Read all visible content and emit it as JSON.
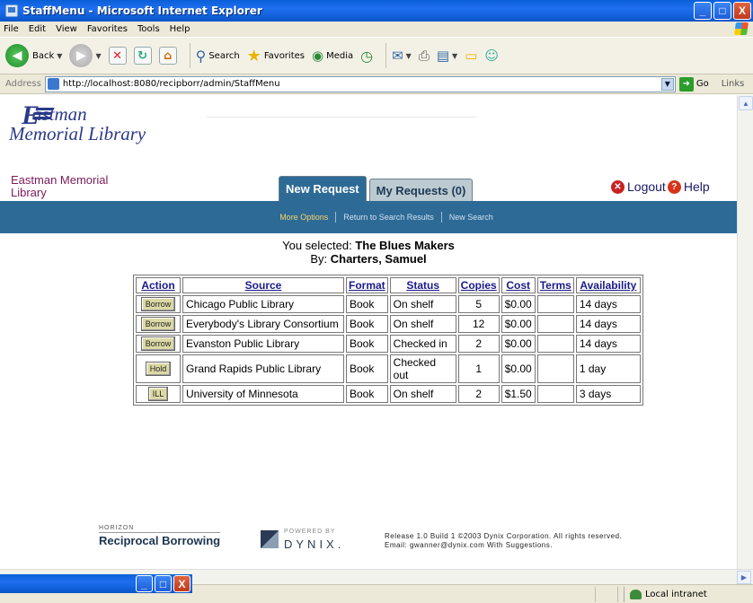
{
  "window": {
    "title": "StaffMenu - Microsoft Internet Explorer",
    "minimize": "_",
    "maximize": "□",
    "close": "X"
  },
  "menu": [
    "File",
    "Edit",
    "View",
    "Favorites",
    "Tools",
    "Help"
  ],
  "toolbar": {
    "back": "Back",
    "search": "Search",
    "favorites": "Favorites",
    "media": "Media"
  },
  "address": {
    "label": "Address",
    "url": "http://localhost:8080/recipborr/admin/StaffMenu",
    "go": "Go",
    "links": "Links"
  },
  "logo": {
    "line1": "astman",
    "line2": "Memorial Library",
    "initial": "E"
  },
  "library_name": "Eastman Memorial Library",
  "tabs": [
    {
      "label": "New Request",
      "active": true
    },
    {
      "label": "My Requests (0)",
      "active": false
    }
  ],
  "header_links": {
    "logout": "Logout",
    "help": "Help"
  },
  "nav": [
    "More Options",
    "Return to Search Results",
    "New Search"
  ],
  "selection": {
    "prefix": "You selected:",
    "title": "The Blues Makers",
    "by_prefix": "By:",
    "author": "Charters, Samuel"
  },
  "table": {
    "headers": [
      "Action",
      "Source",
      "Format",
      "Status",
      "Copies",
      "Cost",
      "Terms",
      "Availability"
    ],
    "rows": [
      {
        "action": "Borrow",
        "source": "Chicago Public Library",
        "format": "Book",
        "status": "On shelf",
        "copies": "5",
        "cost": "$0.00",
        "terms": "",
        "availability": "14 days"
      },
      {
        "action": "Borrow",
        "source": "Everybody's Library Consortium",
        "format": "Book",
        "status": "On shelf",
        "copies": "12",
        "cost": "$0.00",
        "terms": "",
        "availability": "14 days"
      },
      {
        "action": "Borrow",
        "source": "Evanston Public Library",
        "format": "Book",
        "status": "Checked in",
        "copies": "2",
        "cost": "$0.00",
        "terms": "",
        "availability": "14 days"
      },
      {
        "action": "Hold",
        "source": "Grand Rapids Public Library",
        "format": "Book",
        "status": "Checked out",
        "copies": "1",
        "cost": "$0.00",
        "terms": "",
        "availability": "1 day"
      },
      {
        "action": "ILL",
        "source": "University of Minnesota",
        "format": "Book",
        "status": "On shelf",
        "copies": "2",
        "cost": "$1.50",
        "terms": "",
        "availability": "3 days"
      }
    ]
  },
  "footer": {
    "horizon": "HORIZON",
    "product": "Reciprocal Borrowing",
    "powered_by": "POWERED BY",
    "dynix": "DYNIX.",
    "release": "Release 1.0 Build 1 ©2003 Dynix Corporation. All rights reserved.",
    "email": "Email: gwanner@dynix.com With Suggestions."
  },
  "status_bar": {
    "zone": "Local intranet"
  },
  "colors": {
    "accent_blue": "#2e6a96",
    "library_name": "#7b1a5a",
    "nav_highlight": "#f4d46a"
  }
}
